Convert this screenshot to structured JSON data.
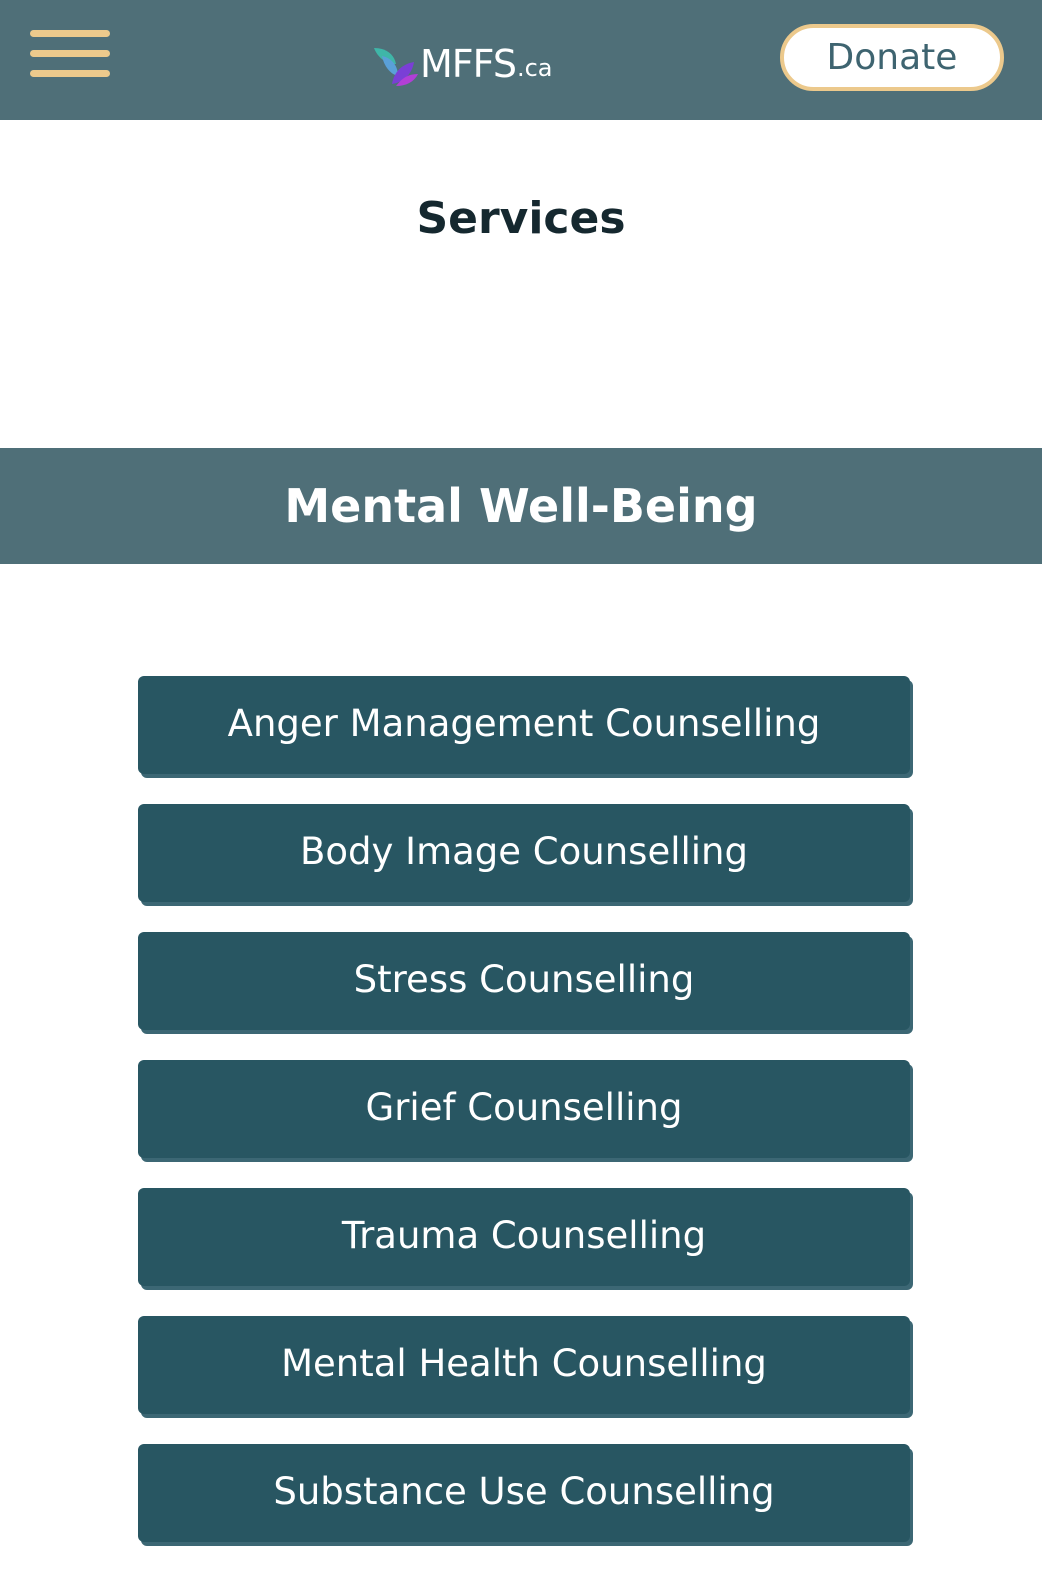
{
  "header": {
    "menu_icon": "hamburger-menu-icon",
    "logo": {
      "text": "MFFS",
      "suffix": ".ca",
      "mark_colors": [
        "#3fb6a8",
        "#7a3fd6",
        "#b23fd6"
      ]
    },
    "donate_label": "Donate"
  },
  "page": {
    "title": "Services"
  },
  "section": {
    "title": "Mental Well-Being"
  },
  "services": [
    "Anger Management Counselling",
    "Body Image Counselling",
    "Stress Counselling",
    "Grief Counselling",
    "Trauma Counselling",
    "Mental Health Counselling",
    "Substance Use Counselling"
  ],
  "colors": {
    "header_bg": "#4f6f78",
    "accent_gold": "#ecc98c",
    "button_bg": "#285662",
    "title_text": "#15282f"
  }
}
